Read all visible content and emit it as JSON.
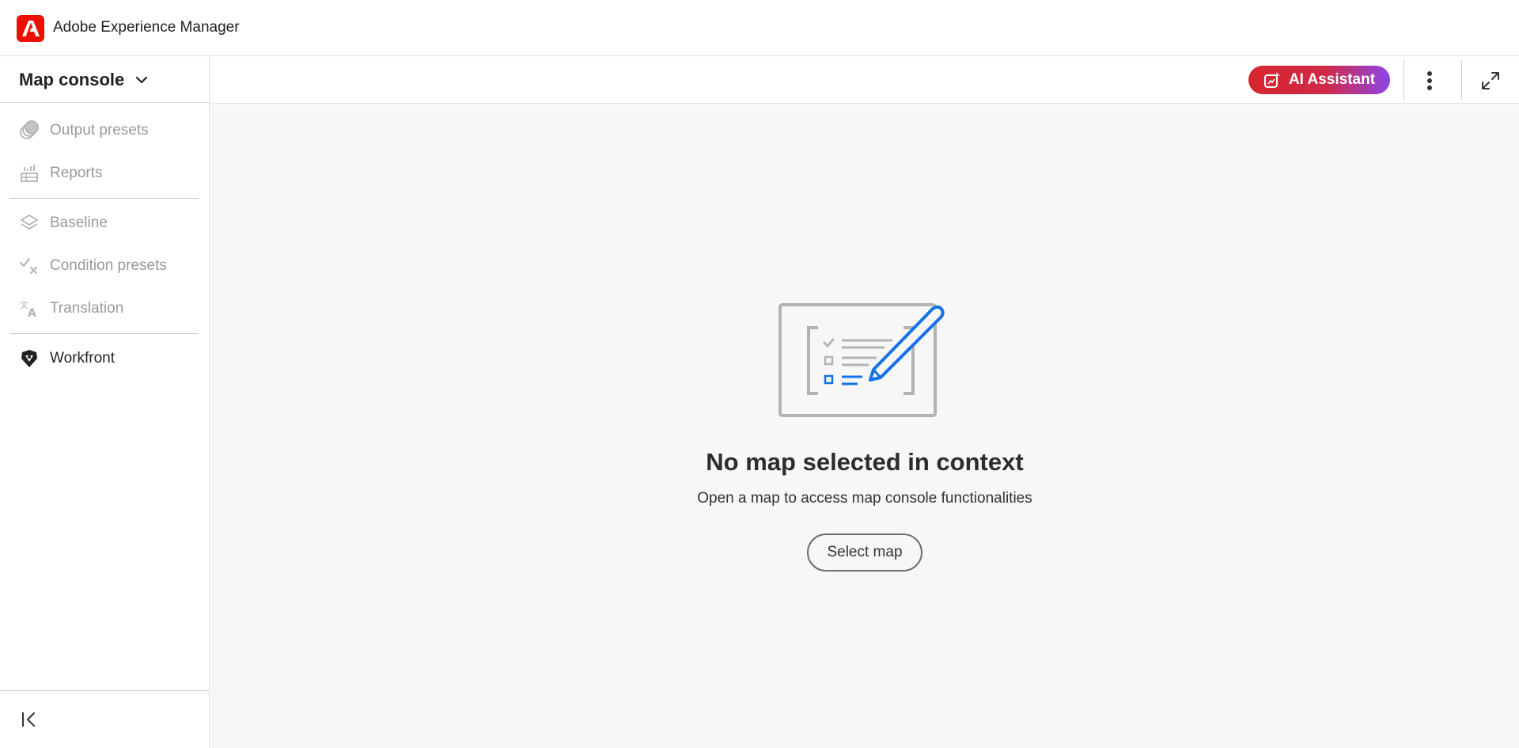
{
  "app": {
    "title": "Adobe Experience Manager",
    "logo_icon": "adobe-icon",
    "brand_color": "#eb1000"
  },
  "sidebar": {
    "header": {
      "title": "Map console",
      "icon": "chevron-down-icon"
    },
    "groups": [
      [
        {
          "label": "Output presets",
          "icon": "output-presets-icon",
          "enabled": false
        },
        {
          "label": "Reports",
          "icon": "reports-icon",
          "enabled": false
        }
      ],
      [
        {
          "label": "Baseline",
          "icon": "layers-icon",
          "enabled": false
        },
        {
          "label": "Condition presets",
          "icon": "check-x-icon",
          "enabled": false
        },
        {
          "label": "Translation",
          "icon": "translate-icon",
          "enabled": false
        }
      ],
      [
        {
          "label": "Workfront",
          "icon": "workfront-icon",
          "enabled": true
        }
      ]
    ],
    "collapse_icon": "collapse-left-icon"
  },
  "toolbar": {
    "ai_assistant_label": "AI Assistant",
    "ai_gradient": [
      "#d7262e",
      "#8b45e8"
    ],
    "more_icon": "more-vertical-icon",
    "expand_icon": "expand-icon"
  },
  "main": {
    "empty_state": {
      "illustration": "checklist-pencil-illustration",
      "title": "No map selected in context",
      "description": "Open a map to access map console functionalities",
      "button_label": "Select map"
    }
  }
}
